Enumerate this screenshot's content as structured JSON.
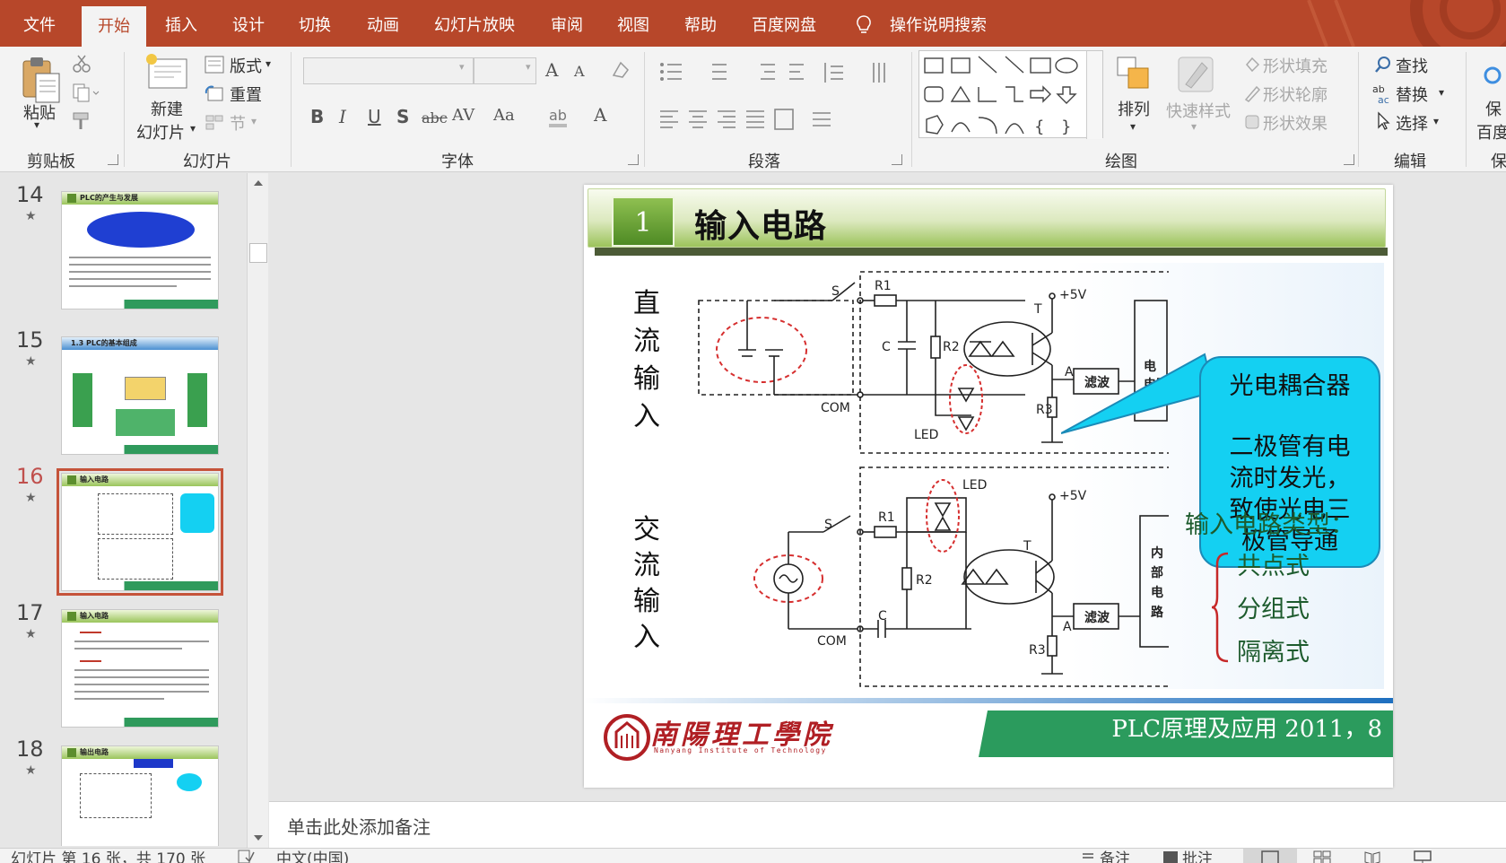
{
  "menu": {
    "tabs": [
      {
        "label": "文件"
      },
      {
        "label": "开始"
      },
      {
        "label": "插入"
      },
      {
        "label": "设计"
      },
      {
        "label": "切换"
      },
      {
        "label": "动画"
      },
      {
        "label": "幻灯片放映"
      },
      {
        "label": "审阅"
      },
      {
        "label": "视图"
      },
      {
        "label": "帮助"
      },
      {
        "label": "百度网盘"
      }
    ],
    "active_tab": "开始",
    "tell_me": "操作说明搜索",
    "accent_color": "#b7472a"
  },
  "ribbon": {
    "clipboard": {
      "paste": "粘贴",
      "label": "剪贴板"
    },
    "slides": {
      "new_slide_1": "新建",
      "new_slide_2": "幻灯片",
      "layout": "版式",
      "reset": "重置",
      "section": "节",
      "label": "幻灯片"
    },
    "font": {
      "label": "字体",
      "bold": "B",
      "italic": "I",
      "underline": "U",
      "shadow": "S",
      "strike": "abc",
      "spacing": "AV",
      "case": "Aa",
      "grow": "A",
      "shrink": "A",
      "color": "A"
    },
    "paragraph": {
      "label": "段落"
    },
    "drawing": {
      "label": "绘图",
      "arrange": "排列",
      "quick_styles": "快速样式",
      "fill": "形状填充",
      "outline": "形状轮廓",
      "effects": "形状效果"
    },
    "editing": {
      "label": "编辑",
      "find": "查找",
      "replace": "替换",
      "select": "选择"
    },
    "extra": {
      "label_1": "保",
      "label_2": "百度",
      "label_3": "保"
    }
  },
  "thumbnails": [
    {
      "num": "14",
      "title": "PLC的产生与发展"
    },
    {
      "num": "15",
      "title": "1.3 PLC的基本组成"
    },
    {
      "num": "16",
      "title": "输入电路",
      "active": true
    },
    {
      "num": "17",
      "title": "输入电路"
    },
    {
      "num": "18",
      "title": "输出电路"
    }
  ],
  "thumb_star": "★",
  "slide": {
    "number": "1",
    "title": "输入电路",
    "dc_label": [
      "直",
      "流",
      "输",
      "入"
    ],
    "ac_label": [
      "交",
      "流",
      "输",
      "入"
    ],
    "callout": {
      "line1": "光电耦合器",
      "line2": "二极管有电",
      "line3": "流时发光，",
      "line4": "致使光电三",
      "line5": "极管导通"
    },
    "types_title": "输入电路类型：",
    "types": [
      "共点式",
      "分组式",
      "隔离式"
    ],
    "circuit_dc": {
      "s": "S",
      "r1": "R1",
      "r2": "R2",
      "r3": "R3",
      "c": "C",
      "t": "T",
      "v5": "+5V",
      "com": "COM",
      "led": "LED",
      "a": "A",
      "filter": "滤波",
      "circuit": "电路",
      "circuit_top": "电"
    },
    "circuit_ac": {
      "s": "S",
      "r1": "R1",
      "r2": "R2",
      "r3": "R3",
      "c": "C",
      "t": "T",
      "v5": "+5V",
      "com": "COM",
      "led": "LED",
      "a": "A",
      "filter": "滤波",
      "internal_1": "内",
      "internal_2": "部",
      "internal_3": "电",
      "internal_4": "路"
    },
    "footer_logo_text": "南陽理工學院",
    "footer_logo_sub": "Nanyang Institute of Technology",
    "footer_text": "PLC原理及应用   2011，8"
  },
  "notes": {
    "placeholder": "单击此处添加备注"
  },
  "status": {
    "slide_info": "幻灯片 第 16 张，共 170 张",
    "language": "中文(中国)",
    "notes_btn": "备注",
    "comments_btn": "批注"
  }
}
